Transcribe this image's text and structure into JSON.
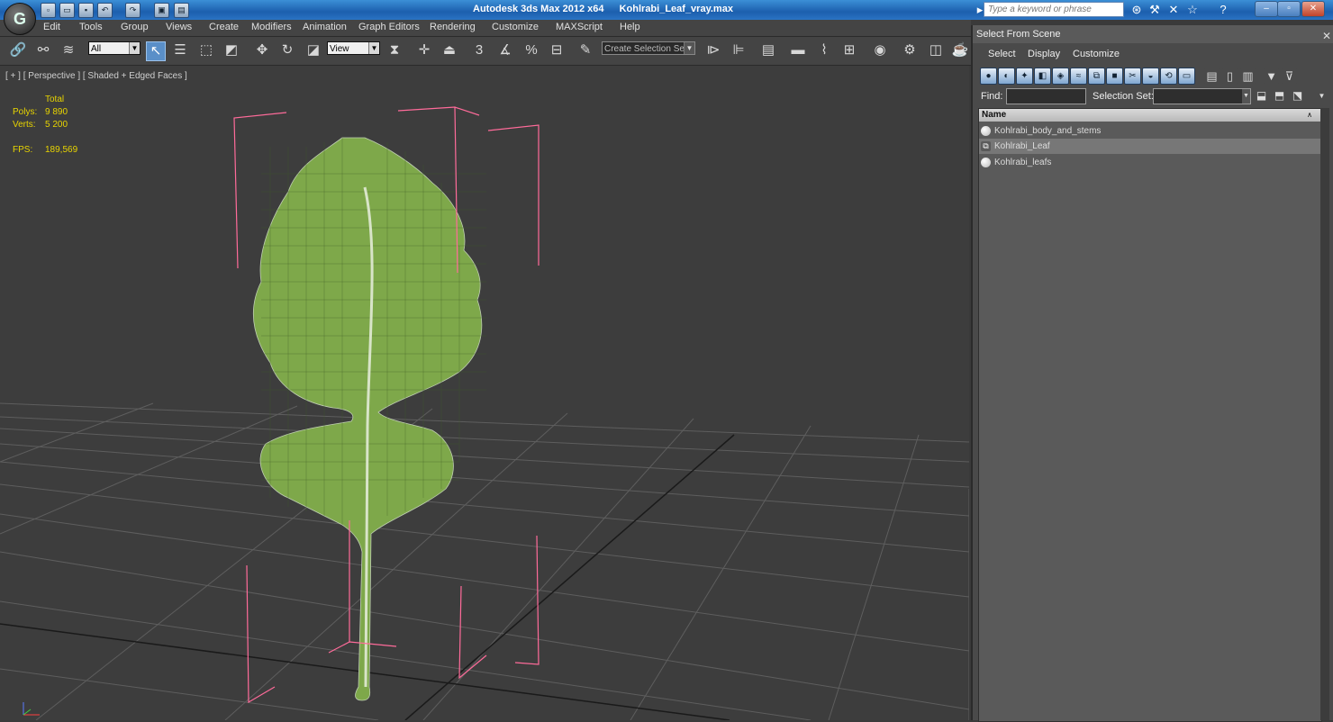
{
  "titlebar": {
    "app": "Autodesk 3ds Max  2012 x64",
    "file": "Kohlrabi_Leaf_vray.max",
    "search_placeholder": "Type a keyword or phrase",
    "logo": "G"
  },
  "menu": [
    "Edit",
    "Tools",
    "Group",
    "Views",
    "Create",
    "Modifiers",
    "Animation",
    "Graph Editors",
    "Rendering",
    "Customize",
    "MAXScript",
    "Help"
  ],
  "toolbar": {
    "filter": "All",
    "coord": "View",
    "named_selection": "Create Selection Se",
    "snap_3": "3",
    "snap_percent": "%"
  },
  "viewport": {
    "label": "[ + ] [ Perspective ] [ Shaded + Edged Faces ]",
    "stats": {
      "total_label": "Total",
      "polys_label": "Polys:",
      "polys_value": "9 890",
      "verts_label": "Verts:",
      "verts_value": "5 200",
      "fps_label": "FPS:",
      "fps_value": "189,569"
    }
  },
  "panel": {
    "title": "Select From Scene",
    "menu": [
      "Select",
      "Display",
      "Customize"
    ],
    "find_label": "Find:",
    "selection_set_label": "Selection Set:",
    "column_name": "Name",
    "objects": [
      {
        "name": "Kohlrabi_body_and_stems",
        "selected": false,
        "icon": "sphere-icon"
      },
      {
        "name": "Kohlrabi_Leaf",
        "selected": true,
        "icon": "group-icon"
      },
      {
        "name": "Kohlrabi_leafs",
        "selected": false,
        "icon": "sphere-icon"
      }
    ]
  },
  "colors": {
    "titlebar": "#1c5fae",
    "viewport_bg": "#3d3d3d",
    "stats": "#e8d400",
    "bbox": "#ff6b9a",
    "leaf": "#7ea84a"
  }
}
